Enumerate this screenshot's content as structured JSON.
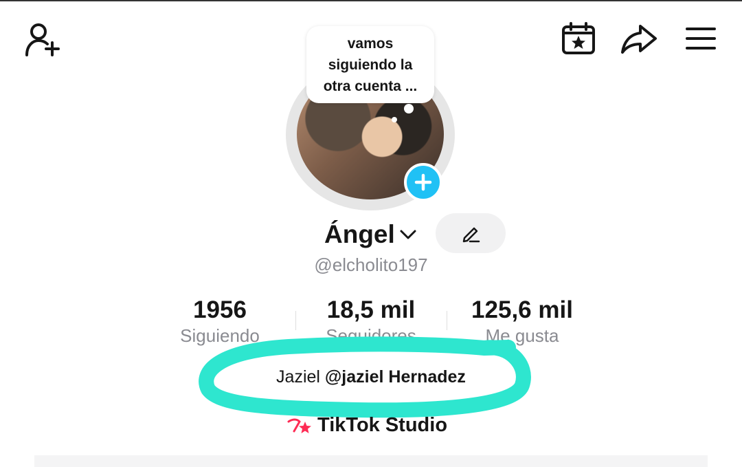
{
  "header": {
    "add_friend_icon": "person-plus-icon",
    "calendar_icon": "calendar-star-icon",
    "share_icon": "share-arrow-icon",
    "menu_icon": "hamburger-menu-icon"
  },
  "note": {
    "lines": [
      "vamos",
      "siguiendo la",
      "otra cuenta ..."
    ]
  },
  "profile": {
    "display_name": "Ángel",
    "username": "@elcholito197",
    "plus_badge_color": "#20c1f5"
  },
  "stats": [
    {
      "value": "1956",
      "label": "Siguiendo"
    },
    {
      "value": "18,5 mil",
      "label": "Seguidores"
    },
    {
      "value": "125,6 mil",
      "label": "Me gusta"
    }
  ],
  "bio": {
    "name": "Jaziel",
    "mention": "@jaziel Hernadez"
  },
  "studio": {
    "label": "TikTok Studio"
  },
  "colors": {
    "highlight": "#2ee6cf",
    "accent_pink": "#fe2c55"
  }
}
